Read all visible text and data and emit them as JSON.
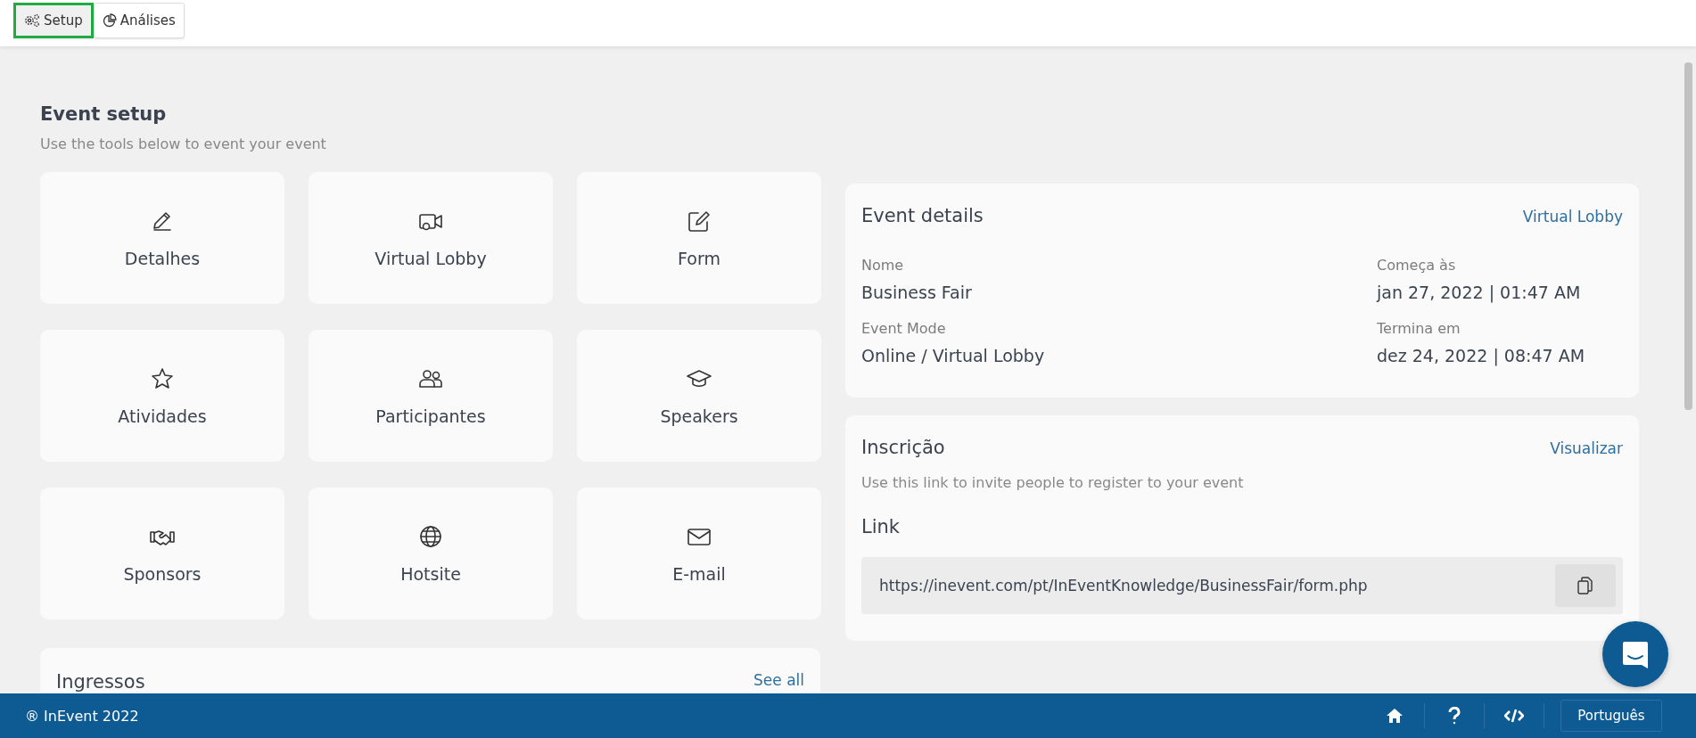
{
  "toolbar": {
    "tabs": [
      {
        "label": "Setup",
        "selected": true
      },
      {
        "label": "Análises",
        "selected": false
      }
    ]
  },
  "setup": {
    "title": "Event setup",
    "subtitle": "Use the tools below to event your event",
    "tiles": [
      {
        "label": "Detalhes"
      },
      {
        "label": "Virtual Lobby"
      },
      {
        "label": "Form"
      },
      {
        "label": "Atividades"
      },
      {
        "label": "Participantes"
      },
      {
        "label": "Speakers"
      },
      {
        "label": "Sponsors"
      },
      {
        "label": "Hotsite"
      },
      {
        "label": "E-mail"
      }
    ]
  },
  "tickets": {
    "title": "Ingressos",
    "link": "See all"
  },
  "event_details": {
    "title": "Event details",
    "link": "Virtual Lobby",
    "fields": [
      {
        "label": "Nome",
        "value": "Business Fair"
      },
      {
        "label": "Começa às",
        "value": "jan 27, 2022 | 01:47 AM"
      },
      {
        "label": "Event Mode",
        "value": "Online / Virtual Lobby"
      },
      {
        "label": "Termina em",
        "value": "dez 24, 2022 | 08:47 AM"
      }
    ]
  },
  "registration": {
    "title": "Inscrição",
    "link": "Visualizar",
    "description": "Use this link to invite people to register to your event",
    "link_heading": "Link",
    "url": "https://inevent.com/pt/InEventKnowledge/BusinessFair/form.php"
  },
  "footer": {
    "copyright": "® InEvent 2022",
    "language": "Português"
  }
}
